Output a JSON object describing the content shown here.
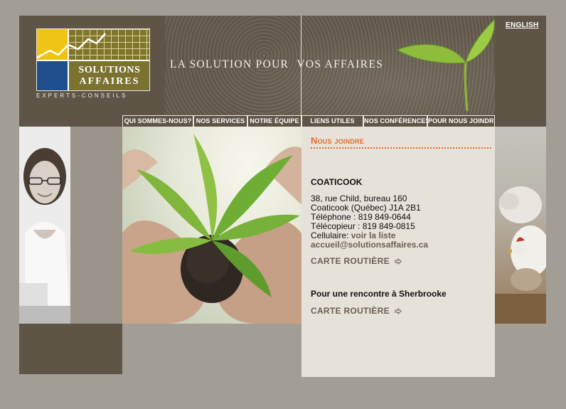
{
  "header": {
    "tagline_part1": "LA SOLUTION POUR",
    "tagline_part2": "VOS AFFAIRES",
    "language_link": "ENGLISH"
  },
  "logo": {
    "name_line1": "SOLUTIONS",
    "name_line2": "AFFAIRES",
    "subtitle": "EXPERTS-CONSEILS",
    "colors": {
      "yellow": "#f0c415",
      "blue": "#1f4e8c",
      "olive": "#7b7231"
    }
  },
  "nav": {
    "items": [
      {
        "label": "QUI SOMMES-NOUS?"
      },
      {
        "label": "NOS SERVICES"
      },
      {
        "label": "NOTRE ÉQUIPE"
      },
      {
        "label": "LIENS UTILES"
      },
      {
        "label": "NOS CONFÉRENCES"
      },
      {
        "label": "POUR NOUS JOINDRE"
      }
    ]
  },
  "content": {
    "title": "Nous joindre",
    "office_name": "COATICOOK",
    "address_line1": "38, rue Child, bureau 160",
    "address_line2": "Coaticook (Québec) J1A 2B1",
    "phone": "Téléphone : 819 849-0644",
    "fax": "Télécopieur : 819 849-0815",
    "cell_label": "Cellulaire:",
    "cell_link": "voir la liste",
    "email": "accueil@solutionsaffaires.ca",
    "route_link_1": "CARTE ROUTIÈRE",
    "sherbrooke_heading": "Pour une rencontre à Sherbrooke",
    "route_link_2": "CARTE ROUTIÈRE",
    "arrow_icon": "arrow-right-icon",
    "accent_color": "#e36d2a"
  }
}
